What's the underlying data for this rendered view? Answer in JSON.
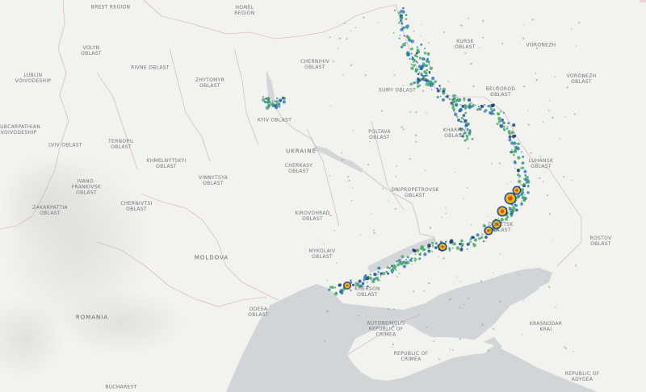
{
  "map": {
    "land_color": "#f2f2ef",
    "water_color": "#d2d5d8",
    "border_color": "#d8a2b8",
    "heat_colors": [
      "#3aa35b",
      "#1f6fb0",
      "#0b2a7a",
      "#e8c21c",
      "#e0421c",
      "#ffffff"
    ]
  },
  "regions": {
    "brest": "BREST REGION",
    "homel": "HOMEL\nREGION",
    "volyn": "VOLYN\nOBLAST",
    "lublin": "LUBLIN\nVOIVODESHIP",
    "rivne": "RIVNE OBLAST",
    "zhytomyr": "ZHYTOMYR\nOBLAST",
    "chernihiv": "CHERNIHIV\nOBLAST",
    "kursk": "KURSK\nOBLAST",
    "voronezh_top": "VORONEZH",
    "voronezh": "VORONEZH\nOBLAST",
    "sumy": "SUMY OBLAST",
    "belgorod": "BELGOROD\nOBLAST",
    "subcarpathian": "SUBCARPATHIAN\nVOIVODESHIP",
    "lviv": "LVIV OBLAST",
    "ternopil": "TERNOPIL\nOBLAST",
    "kyiv": "KYIV OBLAST",
    "poltava": "POLTAVA\nOBLAST",
    "kharkiv": "KHARKIV\nOBLAST",
    "luhansk": "LUHANSK\nOBLAST",
    "khmelnytskyi": "KHMELNYTSKYI\nOBLAST",
    "vinnytsia": "VINNYTSYA\nOBLAST",
    "cherkasy": "CHERKASY\nOBLAST",
    "ukraine": "UKRAINE",
    "ivano": "IVANO-\nFRANKIVSK\nOBLAST",
    "chernivtsi": "CHERNIVTSI\nOBLAST",
    "zakarpattia": "ZAKARPATTIA\nOBLAST",
    "dnipro": "DNIPROPETROVSK\nOBLAST",
    "kirovohrad": "KIROVOHRAD\nOBLAST",
    "donetsk": "DONETSK\nOBLAST",
    "rostov": "ROSTOV\nOBLAST",
    "mykolaiv": "MYKOLAIV\nOBLAST",
    "moldova": "MOLDOVA",
    "odesa": "ODESA\nOBLAST",
    "kherson": "KHERSON\nOBLAST",
    "romania": "ROMANIA",
    "crimea_ar": "AUTONOMOUS\nREPUBLIC OF\nCRIMEA",
    "crimea_rep": "REPUBLIC OF\nCRIMEA",
    "krasnodar": "KRASNODAR\nKRAI",
    "adygea": "REPUBLIC OF\nADYGEA",
    "bucharest": "BUCHAREST"
  }
}
